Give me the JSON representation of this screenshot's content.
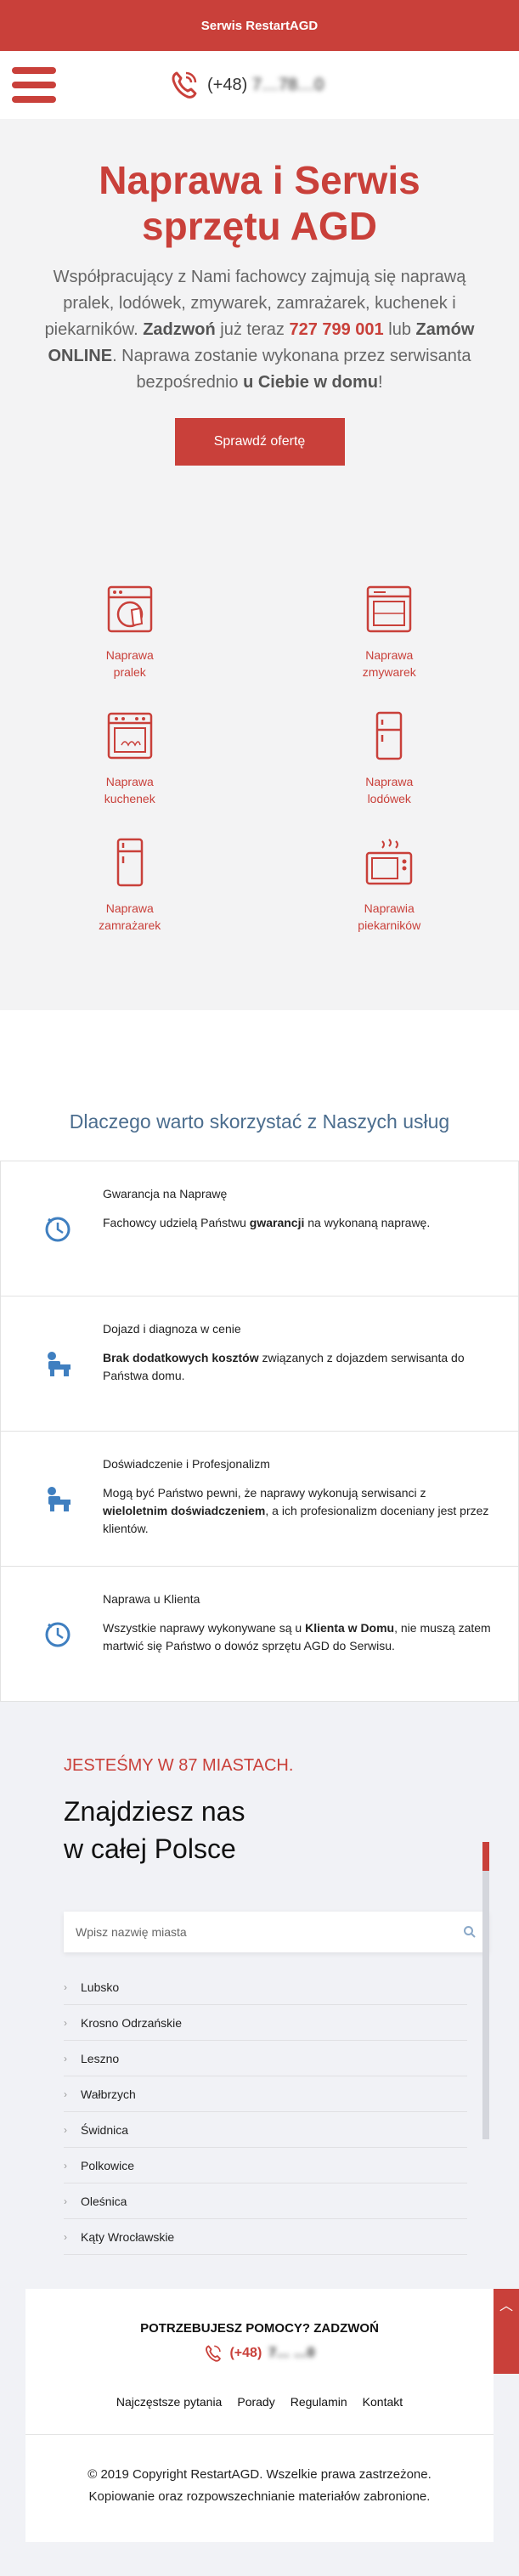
{
  "topbar": {
    "title": "Serwis RestartAGD"
  },
  "header": {
    "phone_prefix": "(+48)",
    "phone_number": "7…78…0"
  },
  "hero": {
    "title": "Naprawa i Serwis sprzętu AGD",
    "text_1": "Współpracujący z Nami fachowcy zajmują się naprawą pralek, lodówek, zmywarek, zamrażarek, kuchenek i piekarników.",
    "text_zadzwon": "Zadzwoń",
    "text_2": "już teraz",
    "text_phone": "727 799 001",
    "text_3": "lub",
    "text_online": "Zamów ONLINE",
    "text_4": ". Naprawa zostanie wykonana przez serwisanta bezpośrednio",
    "text_home": "u Ciebie w domu",
    "text_5": "!",
    "cta": "Sprawdź ofertę"
  },
  "services": [
    {
      "label_1": "Naprawa",
      "label_2": "pralek",
      "icon": "washing-machine-icon"
    },
    {
      "label_1": "Naprawa",
      "label_2": "zmywarek",
      "icon": "dishwasher-icon"
    },
    {
      "label_1": "Naprawa",
      "label_2": "kuchenek",
      "icon": "stove-icon"
    },
    {
      "label_1": "Naprawa",
      "label_2": "lodówek",
      "icon": "fridge-icon"
    },
    {
      "label_1": "Naprawa",
      "label_2": "zamrażarek",
      "icon": "freezer-icon"
    },
    {
      "label_1": "Naprawia",
      "label_2": "piekarników",
      "icon": "oven-icon"
    }
  ],
  "why": {
    "title": "Dlaczego warto skorzystać z Naszych usług",
    "cards": [
      {
        "icon": "clock-icon",
        "title": "Gwarancja na Naprawę",
        "t1": "Fachowcy udzielą Państwu ",
        "b": "gwarancji",
        "t2": " na wykonaną naprawę."
      },
      {
        "icon": "plumber-icon",
        "title": "Dojazd i diagnoza w cenie",
        "t1": "",
        "b": "Brak dodatkowych kosztów",
        "t2": " związanych z dojazdem serwisanta do Państwa domu."
      },
      {
        "icon": "plumber-icon",
        "title": "Doświadczenie i Profesjonalizm",
        "t1": "Mogą być Państwo pewni, że naprawy wykonują serwisanci z ",
        "b": "wieloletnim doświadczeniem",
        "t2": ", a ich profesionalizm doceniany jest przez klientów."
      },
      {
        "icon": "clock-icon",
        "title": "Naprawa u Klienta",
        "t1": "Wszystkie naprawy wykonywane są u ",
        "b": "Klienta w Domu",
        "t2": ", nie muszą zatem martwić się Państwo o dowóz sprzętu AGD do Serwisu."
      }
    ]
  },
  "cities": {
    "eyebrow": "JESTEŚMY W 87 MIASTACH.",
    "title_1": "Znajdziesz nas",
    "title_2": "w całej Polsce",
    "search_placeholder": "Wpisz nazwię miasta",
    "list": [
      "Lubsko",
      "Krosno Odrzańskie",
      "Leszno",
      "Wałbrzych",
      "Świdnica",
      "Polkowice",
      "Oleśnica",
      "Kąty Wrocławskie"
    ]
  },
  "footer": {
    "heading": "POTRZEBUJESZ POMOCY? ZADZWOŃ",
    "phone_prefix": "(+48)",
    "phone_number": "7… …0",
    "links": [
      "Najczęstsze pytania",
      "Porady",
      "Regulamin",
      "Kontakt"
    ],
    "copyright_1": "© 2019 Copyright RestartAGD. Wszelkie prawa zastrzeżone.",
    "copyright_2": "Kopiowanie oraz rozpowszechnianie materiałów zabronione."
  },
  "colors": {
    "brand": "#c9403a",
    "accent_blue": "#4b6d8e",
    "bg_light": "#f3f3f4"
  }
}
